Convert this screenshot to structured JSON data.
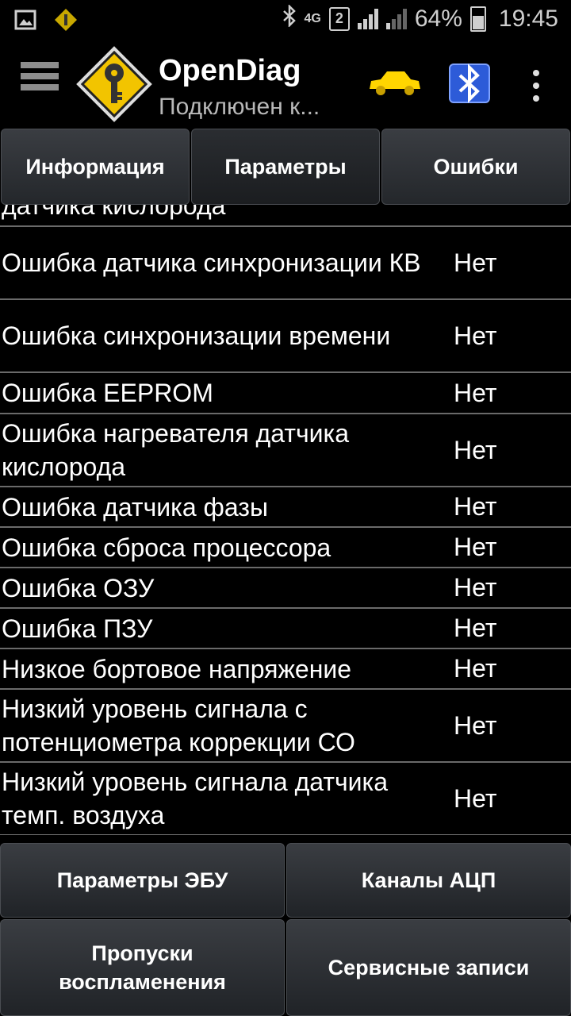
{
  "status_bar": {
    "battery": "64%",
    "time": "19:45",
    "network": "4G",
    "sim": "2"
  },
  "app": {
    "title": "OpenDiag",
    "subtitle": "Подключен к..."
  },
  "tabs": [
    {
      "label": "Информация"
    },
    {
      "label": "Параметры"
    },
    {
      "label": "Ошибки"
    }
  ],
  "list": {
    "cut_top": "датчика кислорода",
    "rows": [
      {
        "name": "Ошибка датчика синхронизации КВ",
        "value": "Нет"
      },
      {
        "name": "Ошибка синхронизации времени",
        "value": "Нет"
      },
      {
        "name": "Ошибка EEPROM",
        "value": "Нет"
      },
      {
        "name": "Ошибка нагревателя датчика кислорода",
        "value": "Нет"
      },
      {
        "name": "Ошибка датчика фазы",
        "value": "Нет"
      },
      {
        "name": "Ошибка сброса процессора",
        "value": "Нет"
      },
      {
        "name": "Ошибка ОЗУ",
        "value": "Нет"
      },
      {
        "name": "Ошибка ПЗУ",
        "value": "Нет"
      },
      {
        "name": "Низкое бортовое напряжение",
        "value": "Нет"
      },
      {
        "name": "Низкий уровень сигнала с потенциометра коррекции СО",
        "value": "Нет"
      },
      {
        "name": "Низкий уровень сигнала датчика темп. воздуха",
        "value": "Нет"
      }
    ]
  },
  "buttons": {
    "ecu_params": "Параметры ЭБУ",
    "adc_channels": "Каналы АЦП",
    "misfires": "Пропуски воспламенения",
    "service_records": "Сервисные записи"
  },
  "colors": {
    "background": "#000000",
    "logo_yellow": "#f2c400",
    "car_yellow": "#ffd500",
    "bt_blue": "#2d5bd8",
    "divider": "#6a6a6a"
  }
}
